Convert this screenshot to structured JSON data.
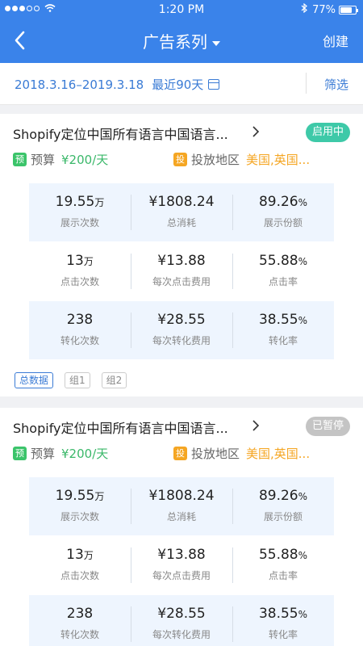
{
  "status_bar": {
    "time": "1:20 PM",
    "battery": "77%",
    "battery_level": 0.77,
    "signal_dots": 5,
    "signal_filled": 3
  },
  "nav": {
    "title": "广告系列",
    "create_label": "创建"
  },
  "date_bar": {
    "range": "2018.3.16–2019.3.18",
    "recent": "最近90天",
    "filter_label": "筛选"
  },
  "colors": {
    "primary": "#3a83ea",
    "active_badge": "#3ec9a8",
    "paused_badge": "#c4c4c4",
    "budget_green": "#3bb86a",
    "region_orange": "#f5a623"
  },
  "campaigns": [
    {
      "title": "Shopify定位中国所有语言中国语言...",
      "status": "启用中",
      "budget_tag": "预",
      "budget_label": "预算",
      "budget_value": "¥200/天",
      "region_tag": "投",
      "region_label": "投放地区",
      "region_value": "美国,英国...",
      "metrics": [
        [
          {
            "num": "19.55",
            "unit": "万",
            "cap": "展示次数"
          },
          {
            "num": "¥1808.24",
            "unit": "",
            "cap": "总消耗"
          },
          {
            "num": "89.26",
            "unit": "%",
            "cap": "展示份额"
          }
        ],
        [
          {
            "num": "13",
            "unit": "万",
            "cap": "点击次数"
          },
          {
            "num": "¥13.88",
            "unit": "",
            "cap": "每次点击费用"
          },
          {
            "num": "55.88",
            "unit": "%",
            "cap": "点击率"
          }
        ],
        [
          {
            "num": "238",
            "unit": "",
            "cap": "转化次数"
          },
          {
            "num": "¥28.55",
            "unit": "",
            "cap": "每次转化费用"
          },
          {
            "num": "38.55",
            "unit": "%",
            "cap": "转化率"
          }
        ]
      ],
      "chips": [
        "总数据",
        "组1",
        "组2"
      ]
    },
    {
      "title": "Shopify定位中国所有语言中国语言...",
      "status": "已暂停",
      "budget_tag": "预",
      "budget_label": "预算",
      "budget_value": "¥200/天",
      "region_tag": "投",
      "region_label": "投放地区",
      "region_value": "美国,英国...",
      "metrics": [
        [
          {
            "num": "19.55",
            "unit": "万",
            "cap": "展示次数"
          },
          {
            "num": "¥1808.24",
            "unit": "",
            "cap": "总消耗"
          },
          {
            "num": "89.26",
            "unit": "%",
            "cap": "展示份额"
          }
        ],
        [
          {
            "num": "13",
            "unit": "万",
            "cap": "点击次数"
          },
          {
            "num": "¥13.88",
            "unit": "",
            "cap": "每次点击费用"
          },
          {
            "num": "55.88",
            "unit": "%",
            "cap": "点击率"
          }
        ],
        [
          {
            "num": "238",
            "unit": "",
            "cap": "转化次数"
          },
          {
            "num": "¥28.55",
            "unit": "",
            "cap": "每次转化费用"
          },
          {
            "num": "38.55",
            "unit": "%",
            "cap": "转化率"
          }
        ]
      ]
    }
  ]
}
